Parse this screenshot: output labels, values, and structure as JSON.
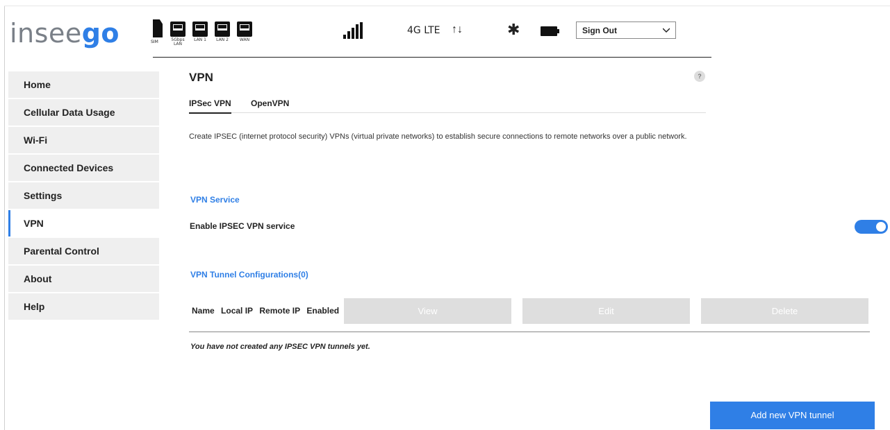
{
  "brand": {
    "logo_light": "insee",
    "logo_bold": "go"
  },
  "status_bar": {
    "sim_label": "SIM",
    "ports": [
      {
        "label": "5Gbps LAN"
      },
      {
        "label": "LAN 1"
      },
      {
        "label": "LAN 2"
      },
      {
        "label": "WAN"
      }
    ],
    "network": "4G LTE",
    "arrows": "↑↓",
    "bluetooth": "✱",
    "signout": "Sign Out"
  },
  "sidebar": {
    "items": [
      {
        "label": "Home"
      },
      {
        "label": "Cellular Data Usage"
      },
      {
        "label": "Wi-Fi"
      },
      {
        "label": "Connected Devices"
      },
      {
        "label": "Settings"
      },
      {
        "label": "VPN"
      },
      {
        "label": "Parental Control"
      },
      {
        "label": "About"
      },
      {
        "label": "Help"
      }
    ],
    "active": "VPN"
  },
  "main": {
    "title": "VPN",
    "help": "?",
    "tabs": [
      {
        "label": "IPSec VPN"
      },
      {
        "label": "OpenVPN"
      }
    ],
    "description": "Create IPSEC (internet protocol security) VPNs (virtual private networks) to establish secure connections to remote networks over a public network.",
    "vpn_service_heading": "VPN Service",
    "enable_label": "Enable IPSEC VPN service",
    "enabled": true,
    "tunnel_heading": "VPN Tunnel Configurations(0)",
    "columns": [
      "Name",
      "Local IP",
      "Remote IP",
      "Enabled"
    ],
    "buttons": {
      "view": "View",
      "edit": "Edit",
      "delete": "Delete",
      "add": "Add new VPN tunnel"
    },
    "empty_message": "You have not created any IPSEC VPN tunnels yet."
  },
  "colors": {
    "accent": "#2f7fe6",
    "nav_bg": "#efefef",
    "disabled_btn": "#dedede"
  }
}
